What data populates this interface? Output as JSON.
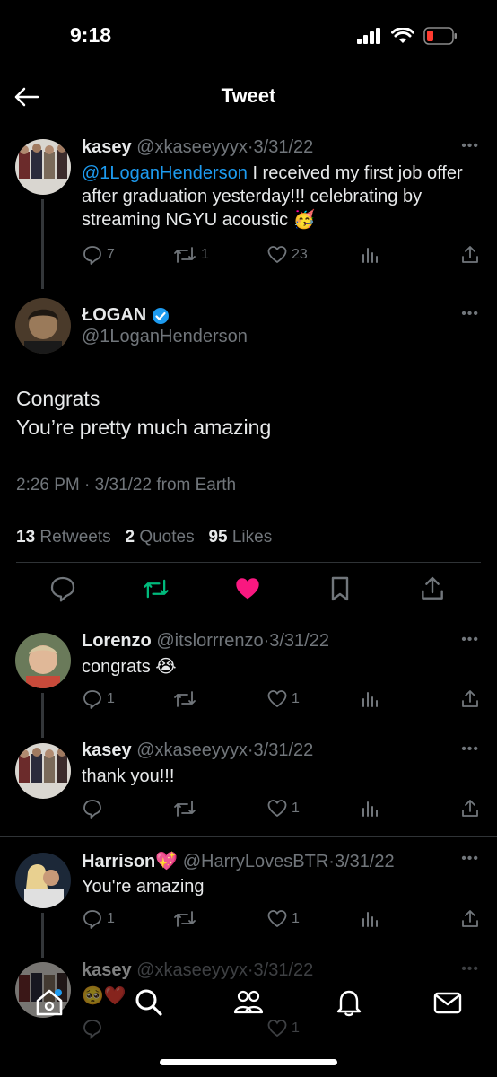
{
  "status_bar": {
    "time": "9:18"
  },
  "header": {
    "title": "Tweet"
  },
  "parent_tweet": {
    "name": "kasey",
    "handle": "@xkaseeyyyx",
    "date": "3/31/22",
    "mention": "@1LoganHenderson",
    "text": " I received my first job offer after graduation yesterday!!! celebrating by streaming NGYU acoustic 🥳",
    "replies": "7",
    "retweets": "1",
    "likes": "23"
  },
  "main_tweet": {
    "name": "ŁOGAN",
    "handle": "@1LoganHenderson",
    "text_line1": "Congrats",
    "text_line2": "You’re pretty much amazing",
    "time": "2:26 PM",
    "date": "3/31/22",
    "source": "from Earth",
    "retweets_count": "13",
    "retweets_label": "Retweets",
    "quotes_count": "2",
    "quotes_label": "Quotes",
    "likes_count": "95",
    "likes_label": "Likes"
  },
  "replies": [
    {
      "name": "Lorenzo",
      "handle": "@itslorrrenzo",
      "date": "3/31/22",
      "text": "congrats 😭",
      "replies": "1",
      "retweets": "",
      "likes": "1"
    },
    {
      "name": "kasey",
      "handle": "@xkaseeyyyx",
      "date": "3/31/22",
      "text": "thank you!!!",
      "replies": "",
      "retweets": "",
      "likes": "1"
    },
    {
      "name": "Harrison💖",
      "handle": "@HarryLovesBTR",
      "date": "3/31/22",
      "text": "You're amazing",
      "replies": "1",
      "retweets": "",
      "likes": "1"
    },
    {
      "name": "kasey",
      "handle": "@xkaseeyyyx",
      "date": "3/31/22",
      "text": "🥺❤️",
      "replies": "",
      "retweets": "",
      "likes": "1"
    }
  ],
  "colors": {
    "background": "#000000",
    "accent": "#1d9bf0",
    "retweet": "#00ba7c",
    "like": "#f91880",
    "muted": "#71767b"
  },
  "tabbar": {
    "items": [
      "home-icon",
      "search-icon",
      "communities-icon",
      "notifications-icon",
      "messages-icon"
    ]
  }
}
